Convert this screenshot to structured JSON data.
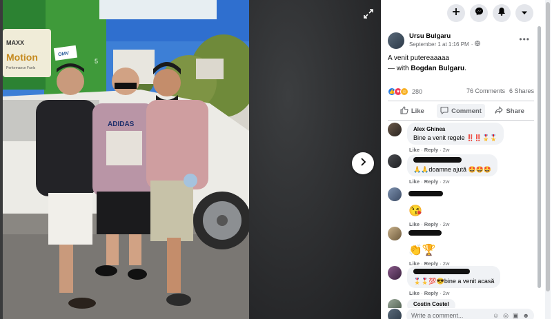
{
  "viewer": {
    "expand_icon": "expand-icon",
    "next_icon": "chevron-right-icon",
    "photo_sign_texts": [
      "MAXX",
      "Motion",
      "Performance Fuels",
      "OMV",
      "5"
    ],
    "shirt_text": "ADIDAS"
  },
  "topbar": {
    "buttons": [
      "plus-icon",
      "messenger-icon",
      "bell-icon",
      "caret-down-icon"
    ]
  },
  "post": {
    "author": "Ursu Bulgaru",
    "date": "September 1 at 1:16 PM",
    "separator": "·",
    "privacy_icon": "globe-icon",
    "more": "•••",
    "text": "A venit putereaaaaa",
    "with_prefix": "— with ",
    "with_name": "Bogdan Bulgaru",
    "with_suffix": "."
  },
  "stats": {
    "reaction_count": "280",
    "comments": "76 Comments",
    "shares": "6 Shares"
  },
  "actions": {
    "like": "Like",
    "comment": "Comment",
    "share": "Share"
  },
  "comments": [
    {
      "name": "Alex Ghinea",
      "text": "Bine a venit regele ‼️‼️🎖️🎖️",
      "like": "Like",
      "reply": "Reply",
      "time": "2w"
    },
    {
      "name": "",
      "text": "🙏🙏doamne ajută 🤩🤩🤩",
      "like": "Like",
      "reply": "Reply",
      "time": "2w"
    },
    {
      "name": "",
      "text": "😘",
      "like": "Like",
      "reply": "Reply",
      "time": "2w"
    },
    {
      "name": "",
      "text": "👏🏆",
      "like": "Like",
      "reply": "Reply",
      "time": "2w"
    },
    {
      "name": "",
      "text": "🎖️🎖️💯😎bine a venit acasă",
      "like": "Like",
      "reply": "Reply",
      "time": "2w"
    },
    {
      "name": "Costin Costel",
      "text": "",
      "like": "",
      "reply": "",
      "time": ""
    }
  ],
  "composer": {
    "placeholder": "Write a comment..."
  },
  "colors": {
    "accent": "#216fdb",
    "panel_bg": "#ffffff",
    "viewer_bg": "#18191a"
  }
}
